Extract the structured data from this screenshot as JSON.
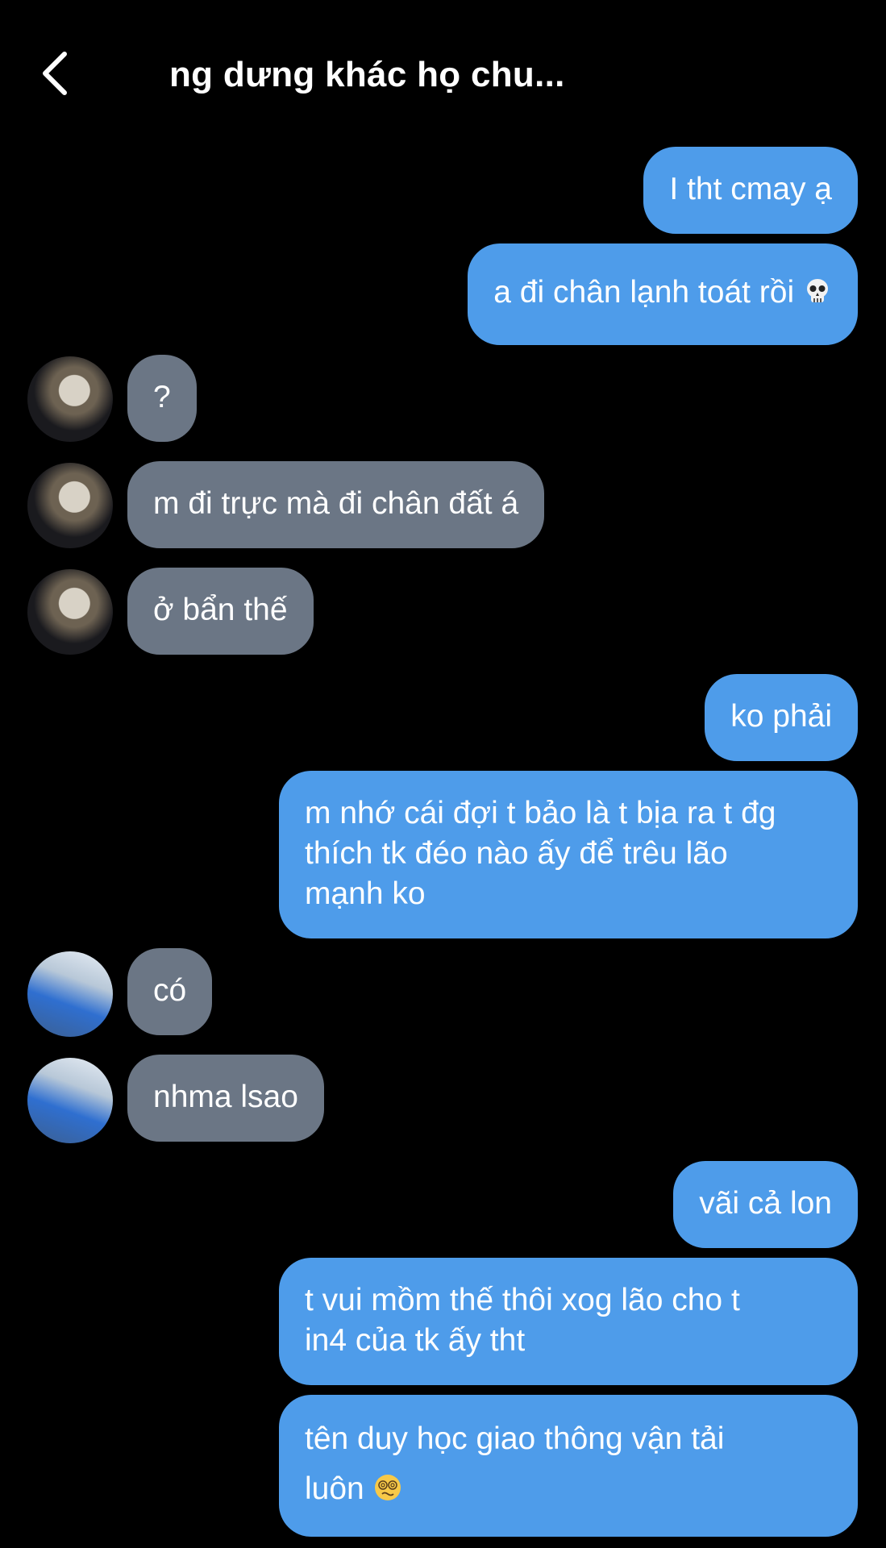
{
  "header": {
    "back_icon": "chevron-left-icon",
    "title": "ng dưng khác họ chu..."
  },
  "messages": [
    {
      "side": "out",
      "text": "I tht cmay ạ"
    },
    {
      "side": "out",
      "text": "a đi chân lạnh toát rồi",
      "emoji": "skull-emoji"
    },
    {
      "side": "in",
      "text": "?"
    },
    {
      "side": "in",
      "text": "m đi trực mà đi chân đất á"
    },
    {
      "side": "in",
      "text": "ở bẩn thế"
    },
    {
      "side": "out",
      "text": "ko phải"
    },
    {
      "side": "out",
      "lines": [
        "m nhớ cái đợi t bảo là t bịa ra t đg",
        "thích tk đéo nào ấy để trêu lão",
        "mạnh ko"
      ]
    },
    {
      "side": "in",
      "text": "có"
    },
    {
      "side": "in",
      "text": "nhma lsao"
    },
    {
      "side": "out",
      "text": "vãi cả lon"
    },
    {
      "side": "out",
      "lines": [
        "t vui mồm thế thôi xog lão cho t",
        "in4 của tk ấy tht"
      ]
    },
    {
      "side": "out",
      "lines": [
        "tên duy học giao thông vận tải",
        "luôn"
      ],
      "emoji": "dizzy-face-emoji"
    }
  ],
  "colors": {
    "outgoing": "#4e9cea",
    "incoming": "#6b7685",
    "background": "#000000"
  }
}
